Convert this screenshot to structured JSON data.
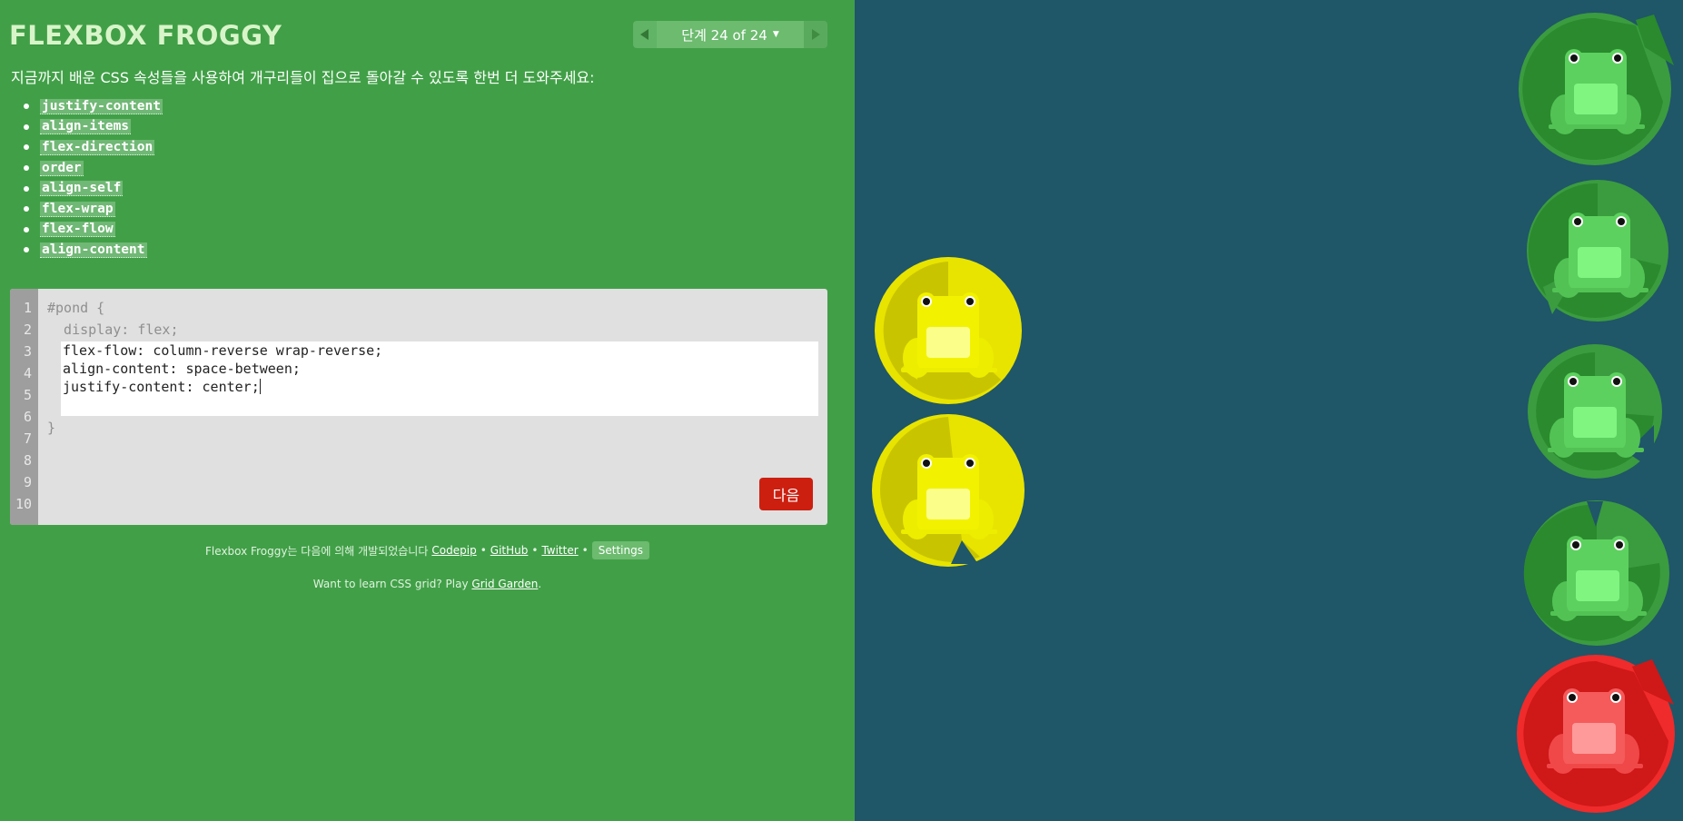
{
  "app": {
    "title": "FLEXBOX FROGGY"
  },
  "level_nav": {
    "label": "단계 24 of 24",
    "prev_icon": "triangle-left-icon",
    "next_icon": "triangle-right-icon",
    "caret_icon": "caret-down-icon"
  },
  "instructions": "지금까지 배운 CSS 속성들을 사용하여 개구리들이 집으로 돌아갈 수 있도록 한번 더 도와주세요:",
  "properties": [
    "justify-content",
    "align-items",
    "flex-direction",
    "order",
    "align-self",
    "flex-wrap",
    "flex-flow",
    "align-content"
  ],
  "editor": {
    "line_numbers": [
      "1",
      "2",
      "3",
      "4",
      "5",
      "6",
      "7",
      "8",
      "9",
      "10"
    ],
    "selector_line": "#pond {",
    "display_line": "  display: flex;",
    "closing_line": "}",
    "input_lines": [
      "flex-flow: column-reverse wrap-reverse;",
      "align-content: space-between;",
      "justify-content: center;"
    ],
    "next_label": "다음"
  },
  "credits": {
    "prefix": "Flexbox Froggy는 다음에 의해 개발되었습니다",
    "codepip": "Codepip",
    "github": "GitHub",
    "twitter": "Twitter",
    "settings": "Settings",
    "separator": "•"
  },
  "promo": {
    "text": "Want to learn CSS grid? Play",
    "link": "Grid Garden",
    "suffix": "."
  },
  "colors": {
    "sidebar_bg": "#41a047",
    "pond_bg": "#1f5668",
    "next_button": "#cc1f10",
    "frog_green": "#54c655",
    "frog_yellow": "#f0ec00",
    "frog_red": "#f3554a"
  }
}
